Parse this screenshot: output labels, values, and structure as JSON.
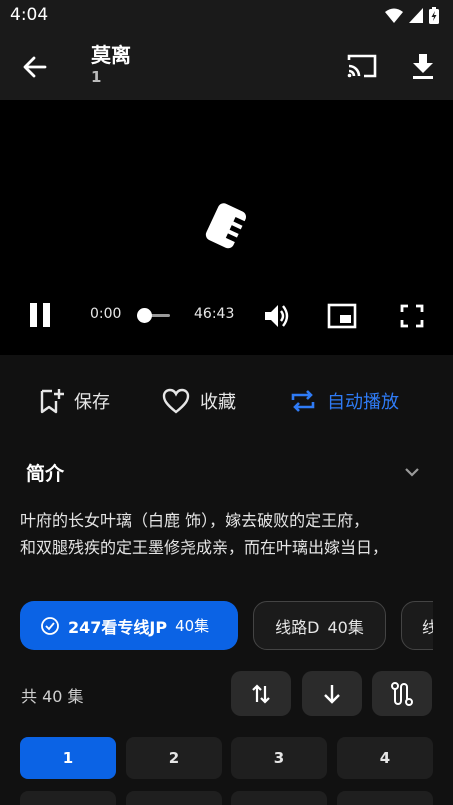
{
  "status": {
    "time": "4:04"
  },
  "header": {
    "title": "莫离",
    "subtitle": "1"
  },
  "player": {
    "current_time": "0:00",
    "total_time": "46:43",
    "progress": 0.0
  },
  "actions": {
    "save": "保存",
    "favorite": "收藏",
    "autoplay": "自动播放"
  },
  "intro": {
    "label": "简介",
    "lines": [
      "叶府的长女叶璃（白鹿 饰），嫁去破败的定王府，",
      "和双腿残疾的定王墨修尧成亲，而在叶璃出嫁当日，"
    ]
  },
  "sources": [
    {
      "label": "247看专线JP",
      "count": "40集"
    },
    {
      "label": "线路D",
      "count": "40集"
    },
    {
      "label": "线"
    }
  ],
  "episodes_bar": {
    "count_label": "共 40 集"
  },
  "episodes": [
    "1",
    "2",
    "3",
    "4"
  ],
  "colors": {
    "accent": "#0b63e5",
    "background": "#111111",
    "autoplay": "#2f7bf5"
  },
  "icons": [
    "back-arrow-icon",
    "cast-icon",
    "download-icon",
    "pause-icon",
    "volume-icon",
    "pip-icon",
    "fullscreen-icon",
    "bookmark-add-icon",
    "heart-icon",
    "repeat-icon",
    "chevron-down-icon",
    "check-circle-icon",
    "sort-swap-icon",
    "arrow-down-icon",
    "route-icon"
  ]
}
